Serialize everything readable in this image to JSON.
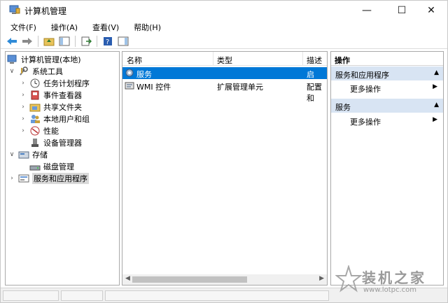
{
  "window": {
    "title": "计算机管理"
  },
  "controls": {
    "minimize": "—",
    "maximize": "☐",
    "close": "✕"
  },
  "menu": [
    "文件(F)",
    "操作(A)",
    "查看(V)",
    "帮助(H)"
  ],
  "tree": [
    {
      "label": "计算机管理(本地)",
      "icon": "computer-management-icon",
      "expander": ""
    },
    {
      "label": "系统工具",
      "icon": "system-tools-icon",
      "expander": "∨"
    },
    {
      "label": "任务计划程序",
      "icon": "task-scheduler-icon",
      "expander": "›"
    },
    {
      "label": "事件查看器",
      "icon": "event-viewer-icon",
      "expander": "›"
    },
    {
      "label": "共享文件夹",
      "icon": "shared-folder-icon",
      "expander": "›"
    },
    {
      "label": "本地用户和组",
      "icon": "local-users-icon",
      "expander": "›"
    },
    {
      "label": "性能",
      "icon": "performance-icon",
      "expander": "›"
    },
    {
      "label": "设备管理器",
      "icon": "device-manager-icon",
      "expander": ""
    },
    {
      "label": "存储",
      "icon": "storage-icon",
      "expander": "∨"
    },
    {
      "label": "磁盘管理",
      "icon": "disk-management-icon",
      "expander": ""
    },
    {
      "label": "服务和应用程序",
      "icon": "services-apps-icon",
      "expander": "›"
    }
  ],
  "list": {
    "columns": [
      "名称",
      "类型",
      "描述"
    ],
    "rows": [
      {
        "name": "服务",
        "type": "",
        "desc": "启动、",
        "icon": "services-gear-icon"
      },
      {
        "name": "WMI 控件",
        "type": "扩展管理单元",
        "desc": "配置和",
        "icon": "wmi-control-icon"
      }
    ]
  },
  "actions": {
    "title": "操作",
    "sections": [
      {
        "label": "服务和应用程序",
        "item": "更多操作"
      },
      {
        "label": "服务",
        "item": "更多操作"
      }
    ]
  },
  "watermark": {
    "text": "装机之家",
    "url": "www.lotpc.com"
  },
  "colors": {
    "selection": "#0078d7",
    "section_bg": "#d8e4f3"
  }
}
